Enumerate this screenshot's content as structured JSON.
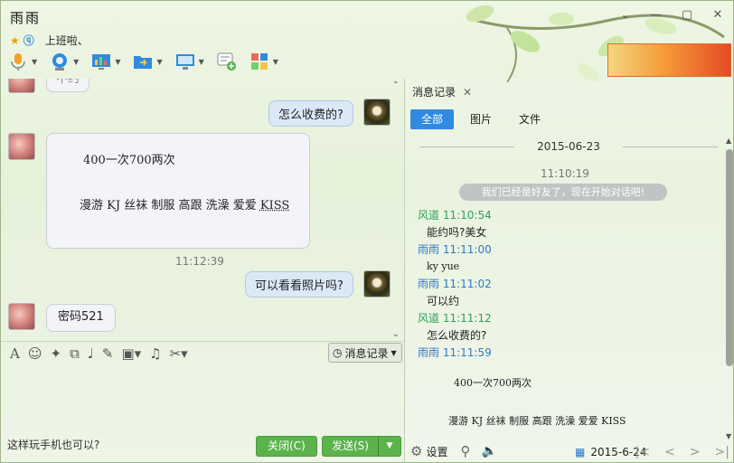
{
  "window": {
    "title": "雨雨",
    "signature": "上班啦、"
  },
  "chat": {
    "top_partial_text": "不约",
    "messages": [
      {
        "side": "right",
        "text": "怎么收费的?"
      },
      {
        "side": "left",
        "line1": "400一次700两次",
        "line2": "漫游 KJ 丝袜 制服 高跟 洗澡 爱爱",
        "line2_kiss": "KISS"
      },
      {
        "side": "time",
        "text": "11:12:39"
      },
      {
        "side": "right",
        "text": "可以看看照片吗?"
      },
      {
        "side": "left",
        "text": "密码521"
      }
    ]
  },
  "input": {
    "history_button": "消息记录",
    "text": "这样玩手机也可以?",
    "close_button": "关闭(C)",
    "send_button": "发送(S)"
  },
  "history": {
    "tab_label": "消息记录",
    "filters": [
      "全部",
      "图片",
      "文件"
    ],
    "date": "2015-06-23",
    "first_time": "11:10:19",
    "system_message": "我们已经是好友了，现在开始对话吧!",
    "entries": [
      {
        "sender": "风道",
        "time": "11:10:54",
        "type": "other",
        "msg": "能约吗?美女"
      },
      {
        "sender": "雨雨",
        "time": "11:11:00",
        "type": "self",
        "msg": "ky yue"
      },
      {
        "sender": "雨雨",
        "time": "11:11:02",
        "type": "self",
        "msg": "可以约"
      },
      {
        "sender": "风道",
        "time": "11:11:12",
        "type": "other",
        "msg": "怎么收费的?"
      },
      {
        "sender": "雨雨",
        "time": "11:11:59",
        "type": "self",
        "msg": ""
      }
    ],
    "long_msg_line1": "400一次700两次",
    "long_msg_line2": "漫游 KJ 丝袜 制服 高跟 洗澡 爱爱 KISS",
    "footer": {
      "settings": "设置",
      "date": "2015-6-24"
    }
  },
  "colors": {
    "accent": "#2f8ae0",
    "send_green": "#5cb34c",
    "other_name": "#2fa05a",
    "self_name": "#2f78c8"
  }
}
